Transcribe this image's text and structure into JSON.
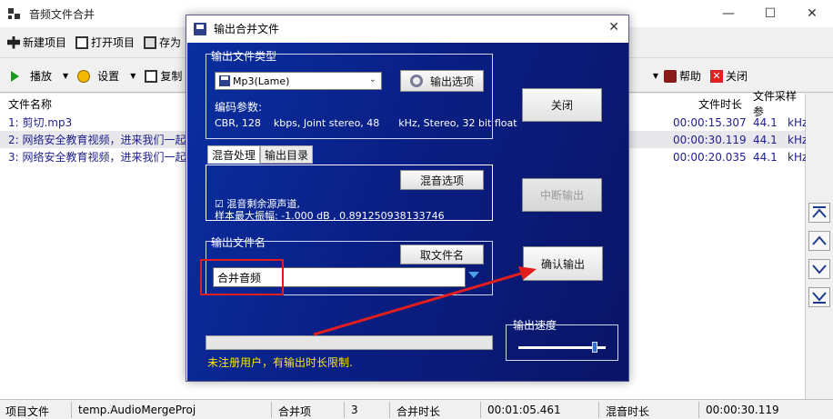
{
  "window": {
    "title": "音频文件合并",
    "minimize": "—",
    "maximize": "☐",
    "close": "✕"
  },
  "toolbar1": {
    "items": [
      "新建项目",
      "打开项目",
      "存为"
    ]
  },
  "toolbar2": {
    "play": "播放",
    "settings": "设置",
    "copy": "复制",
    "help": "帮助",
    "close": "关闭"
  },
  "filelist": {
    "headers": {
      "name": "文件名称",
      "duration": "文件时长",
      "rate": "文件采样参"
    },
    "rows": [
      {
        "name": "1: 剪切.mp3",
        "duration": "00:00:15.307",
        "rate": "44.1",
        "unit": "kHz"
      },
      {
        "name": "2: 网络安全教育视频，进来我们一起",
        "duration": "00:00:30.119",
        "rate": "44.1",
        "unit": "kHz"
      },
      {
        "name": "3: 网络安全教育视频，进来我们一起",
        "duration": "00:00:20.035",
        "rate": "44.1",
        "unit": "kHz"
      }
    ]
  },
  "statusbar": {
    "project_label": "项目文件",
    "project_value": "temp.AudioMergeProj",
    "items_label": "合并项",
    "items_value": "3",
    "total_label": "合并时长",
    "total_value": "00:01:05.461",
    "mix_label": "混音时长",
    "mix_value": "00:00:30.119"
  },
  "dialog": {
    "title": "输出合并文件",
    "close": "✕",
    "type_group": "输出文件类型",
    "format": "Mp3(Lame)",
    "output_options": "输出选项",
    "encode_label": "编码参数:",
    "encode_value": "CBR, 128    kbps, Joint stereo, 48      kHz, Stereo, 32 bit float",
    "tab_mix": "混音处理",
    "tab_dir": "输出目录",
    "mix_options": "混音选项",
    "mix_line1": "☑ 混音剩余源声道,",
    "mix_line2": "样本最大振幅: -1.000 dB , 0.891250938133746",
    "filename_group": "输出文件名",
    "get_filename": "取文件名",
    "filename_value": "合并音频",
    "close_btn": "关闭",
    "interrupt_btn": "中断输出",
    "confirm_btn": "确认输出",
    "speed_group": "输出速度",
    "speed_level": 0.88,
    "warning": "未注册用户，有输出时长限制."
  },
  "colors": {
    "dialog_bg": "#0a1f85",
    "highlight_box": "#e01e1e",
    "annotation_arrow": "#e01e1e",
    "warning_text": "#ffe600",
    "list_text": "#1e1e8c"
  }
}
